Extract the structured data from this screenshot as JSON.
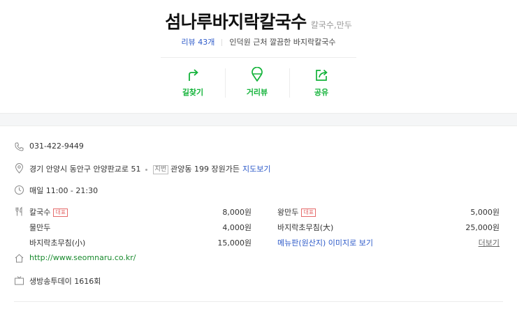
{
  "header": {
    "title": "섬나루바지락칼국수",
    "category": "칼국수,만두",
    "review": "리뷰 43개",
    "description": "인덕원 근처 깔끔한 바지락칼국수"
  },
  "actions": [
    {
      "label": "길찾기",
      "icon": "directions-icon"
    },
    {
      "label": "거리뷰",
      "icon": "street-view-icon"
    },
    {
      "label": "공유",
      "icon": "share-icon"
    }
  ],
  "info": {
    "phone": "031-422-9449",
    "address": "경기 안양시 동안구 안양판교로 51",
    "jibun_tag": "지번",
    "jibun": "관양동 199 장원가든",
    "map_link": "지도보기",
    "hours": "매일 11:00 - 21:30",
    "website": "http://www.seomnaru.co.kr/",
    "tv": "생방송투데이 1616회"
  },
  "menu": {
    "left": [
      {
        "name": "칼국수",
        "badge": "대표",
        "price": "8,000원"
      },
      {
        "name": "물만두",
        "badge": "",
        "price": "4,000원"
      },
      {
        "name": "바지락초무침(小)",
        "badge": "",
        "price": "15,000원"
      }
    ],
    "right": [
      {
        "name": "왕만두",
        "badge": "대표",
        "price": "5,000원"
      },
      {
        "name": "바지락초무침(大)",
        "badge": "",
        "price": "25,000원"
      }
    ],
    "menu_board_link": "메뉴판(원산지) 이미지로 보기",
    "more_link": "더보기"
  },
  "colors": {
    "accent_green": "#13b33a",
    "link_blue": "#2d5ac9",
    "badge_red": "#e56b6b"
  }
}
